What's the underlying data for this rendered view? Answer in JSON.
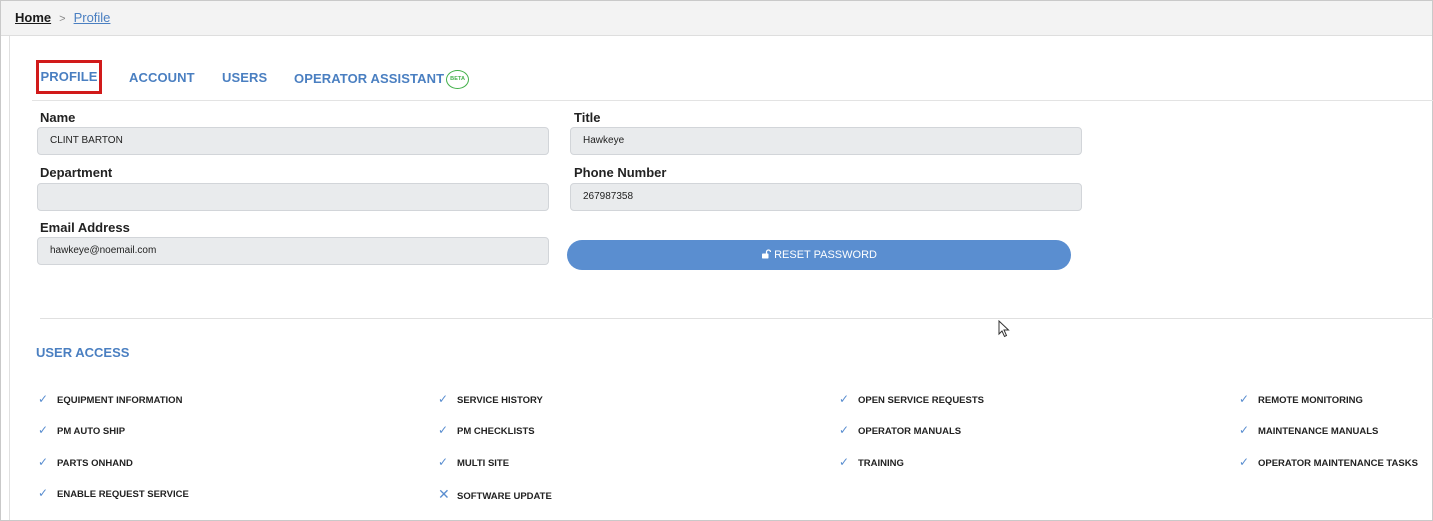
{
  "breadcrumb": {
    "home": "Home",
    "separator": ">",
    "current": "Profile"
  },
  "tabs": [
    {
      "label": "PROFILE",
      "active": true
    },
    {
      "label": "ACCOUNT"
    },
    {
      "label": "USERS"
    },
    {
      "label": "OPERATOR ASSISTANT",
      "badge": "BETA"
    }
  ],
  "form": {
    "name": {
      "label": "Name",
      "value": "CLINT BARTON"
    },
    "title": {
      "label": "Title",
      "value": "Hawkeye"
    },
    "department": {
      "label": "Department",
      "value": ""
    },
    "phone": {
      "label": "Phone Number",
      "value": "267987358"
    },
    "email": {
      "label": "Email Address",
      "value": "hawkeye@noemail.com"
    },
    "reset_password_label": "RESET PASSWORD"
  },
  "user_access": {
    "title": "USER ACCESS",
    "items": [
      {
        "label": "EQUIPMENT INFORMATION",
        "enabled": true
      },
      {
        "label": "SERVICE HISTORY",
        "enabled": true
      },
      {
        "label": "OPEN SERVICE REQUESTS",
        "enabled": true
      },
      {
        "label": "REMOTE MONITORING",
        "enabled": true
      },
      {
        "label": "PM AUTO SHIP",
        "enabled": true
      },
      {
        "label": "PM CHECKLISTS",
        "enabled": true
      },
      {
        "label": "OPERATOR MANUALS",
        "enabled": true
      },
      {
        "label": "MAINTENANCE MANUALS",
        "enabled": true
      },
      {
        "label": "PARTS ONHAND",
        "enabled": true
      },
      {
        "label": "MULTI SITE",
        "enabled": true
      },
      {
        "label": "TRAINING",
        "enabled": true
      },
      {
        "label": "OPERATOR MAINTENANCE TASKS",
        "enabled": true
      },
      {
        "label": "ENABLE REQUEST SERVICE",
        "enabled": true
      },
      {
        "label": "SOFTWARE UPDATE",
        "enabled": false
      }
    ]
  },
  "colors": {
    "accent": "#4a7fc1",
    "button": "#5a8ed0",
    "badge": "#43b04a",
    "highlight": "#d11a1a",
    "input_bg": "#e9ebed"
  }
}
